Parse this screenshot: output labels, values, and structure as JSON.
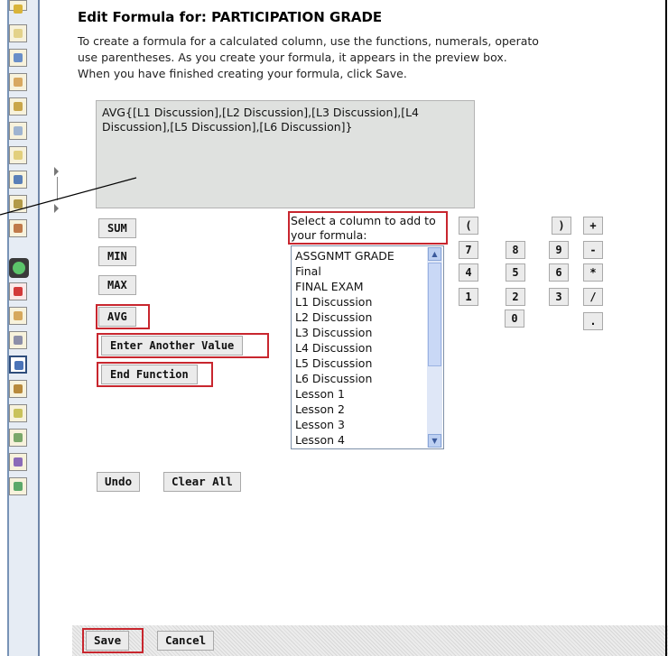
{
  "page": {
    "title": "Edit Formula for: PARTICIPATION GRADE",
    "instructions": [
      "To create a formula for a calculated column, use the functions, numerals, operato",
      "use parentheses. As you create your formula, it appears in the preview box.",
      "When you have finished creating your formula, click Save."
    ]
  },
  "preview": {
    "formula": "AVG{[L1 Discussion],[L2 Discussion],[L3 Discussion],[L4 Discussion],[L5 Discussion],[L6 Discussion]}"
  },
  "functions": {
    "sum": "SUM",
    "min": "MIN",
    "max": "MAX",
    "avg": "AVG",
    "enter_value": "Enter Another Value",
    "end_function": "End Function"
  },
  "columns": {
    "label": "Select a column to add to your formula:",
    "options": [
      "ASSGNMT GRADE",
      "Final",
      "FINAL EXAM",
      "L1 Discussion",
      "L2 Discussion",
      "L3 Discussion",
      "L4 Discussion",
      "L5 Discussion",
      "L6 Discussion",
      "Lesson 1",
      "Lesson 2",
      "Lesson 3",
      "Lesson 4"
    ]
  },
  "keypad": {
    "open_paren": "(",
    "close_paren": ")",
    "plus": "+",
    "seven": "7",
    "eight": "8",
    "nine": "9",
    "minus": "-",
    "four": "4",
    "five": "5",
    "six": "6",
    "multiply": "*",
    "one": "1",
    "two": "2",
    "three": "3",
    "divide": "/",
    "zero": "0",
    "decimal": "."
  },
  "actions": {
    "undo": "Undo",
    "clear_all": "Clear All",
    "save": "Save",
    "cancel": "Cancel"
  },
  "colors": {
    "highlight": "#c8262e",
    "preview_bg": "#dfe1df",
    "toolbar_border": "#7893b6"
  }
}
